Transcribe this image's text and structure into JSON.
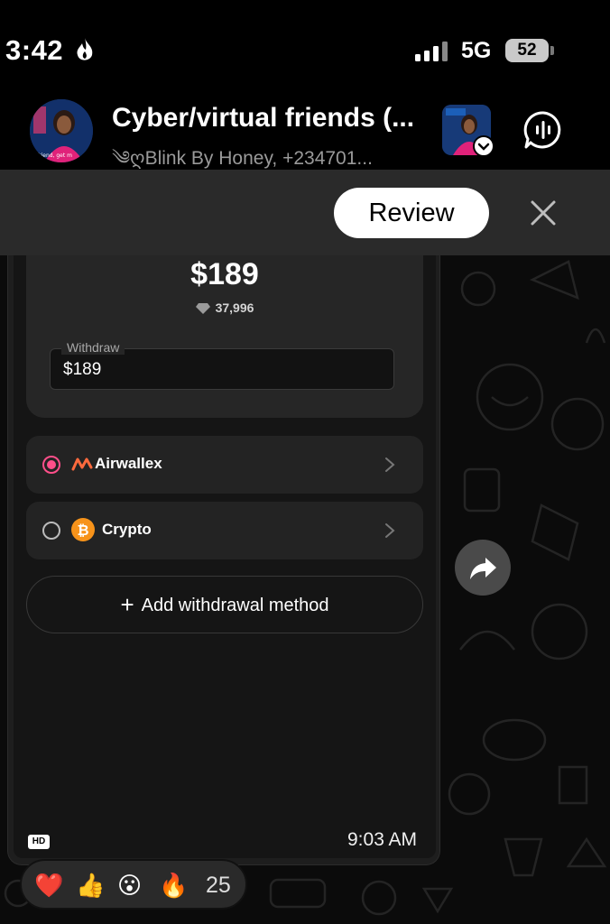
{
  "status_bar": {
    "time": "3:42",
    "network": "5G",
    "battery": "52"
  },
  "chat_header": {
    "title": "Cyber/virtual friends (...",
    "subtitle": "༄ღBlink By Honey, +234701...",
    "avatar_text": "friend, get m"
  },
  "review_bar": {
    "review_label": "Review"
  },
  "message": {
    "balance_amount": "$189",
    "diamond_count": "37,996",
    "withdraw_label": "Withdraw",
    "withdraw_value": "$189",
    "methods": [
      {
        "label": "Airwallex",
        "selected": true,
        "icon": "airwallex-logo"
      },
      {
        "label": "Crypto",
        "selected": false,
        "icon": "bitcoin-icon"
      }
    ],
    "add_method_label": "Add withdrawal method",
    "hd_badge": "HD",
    "timestamp": "9:03 AM"
  },
  "reactions": {
    "emojis": [
      "❤️",
      "👍",
      "😮",
      "🔥"
    ],
    "count": "25"
  },
  "colors": {
    "accent_pink": "#ff4f8a",
    "airwallex_orange": "#ff6a3d",
    "bitcoin_orange": "#f7931a"
  }
}
